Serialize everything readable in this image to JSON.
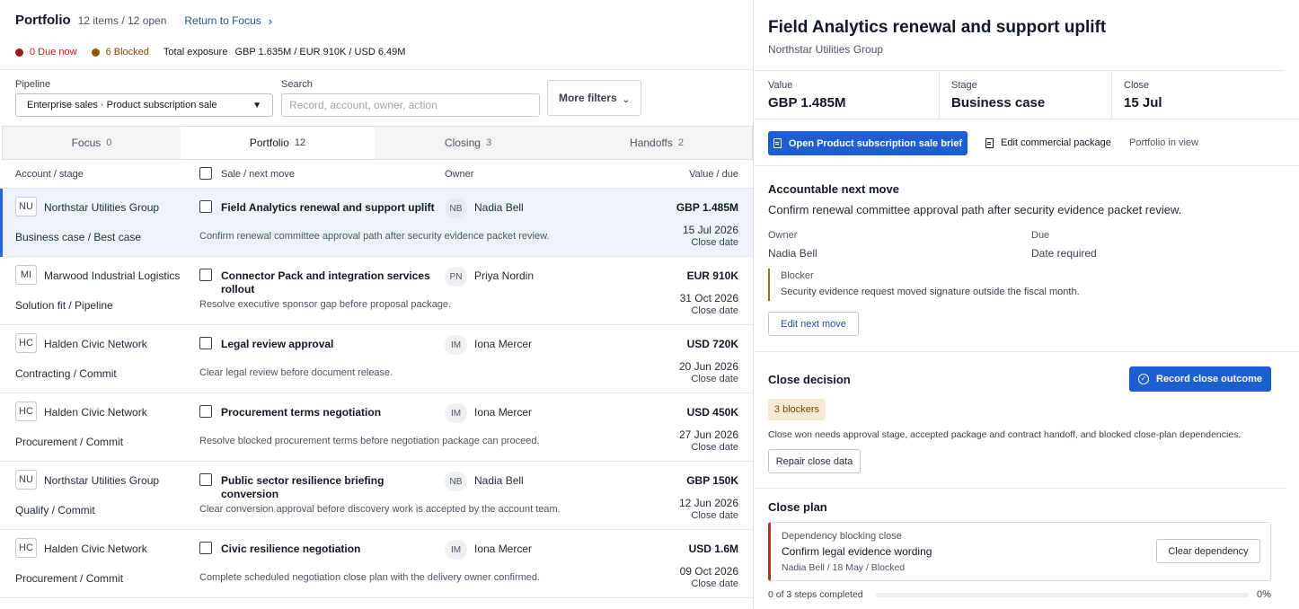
{
  "header": {
    "title": "Portfolio",
    "count": "12 items / 12 open",
    "return_link": "Return to Focus",
    "due_now": "0 Due now",
    "blocked": "6 Blocked",
    "exposure_label": "Total exposure",
    "exposure_value": "GBP 1.635M / EUR 910K / USD 6.49M"
  },
  "colors": {
    "accent": "#1d5fd1",
    "due": "#b91c1c",
    "blocked": "#8a5a00",
    "danger": "#c62828"
  },
  "filters": {
    "pipeline_label": "Pipeline",
    "pipeline_value": "Enterprise sales · Product subscription sale",
    "search_label": "Search",
    "search_placeholder": "Record, account, owner, action",
    "more_filters": "More filters"
  },
  "tabs": [
    {
      "label": "Focus",
      "count": "0"
    },
    {
      "label": "Portfolio",
      "count": "12"
    },
    {
      "label": "Closing",
      "count": "3"
    },
    {
      "label": "Handoffs",
      "count": "2"
    }
  ],
  "columns": {
    "account": "Account / stage",
    "sale": "Sale / next move",
    "owner": "Owner",
    "value": "Value / due"
  },
  "rows": [
    {
      "initials": "NU",
      "account": "Northstar Utilities Group",
      "stage": "Business case / Best case",
      "sale": "Field Analytics renewal and support uplift",
      "next": "Confirm renewal committee approval path after security evidence packet review.",
      "owner_initials": "NB",
      "owner": "Nadia Bell",
      "value": "GBP 1.485M",
      "date": "15 Jul 2026",
      "date_label": "Close date"
    },
    {
      "initials": "MI",
      "account": "Marwood Industrial Logistics",
      "stage": "Solution fit / Pipeline",
      "sale": "Connector Pack and integration services rollout",
      "next": "Resolve executive sponsor gap before proposal package.",
      "owner_initials": "PN",
      "owner": "Priya Nordin",
      "value": "EUR 910K",
      "date": "31 Oct 2026",
      "date_label": "Close date"
    },
    {
      "initials": "HC",
      "account": "Halden Civic Network",
      "stage": "Contracting / Commit",
      "sale": "Legal review approval",
      "next": "Clear legal review before document release.",
      "owner_initials": "IM",
      "owner": "Iona Mercer",
      "value": "USD 720K",
      "date": "20 Jun 2026",
      "date_label": "Close date"
    },
    {
      "initials": "HC",
      "account": "Halden Civic Network",
      "stage": "Procurement / Commit",
      "sale": "Procurement terms negotiation",
      "next": "Resolve blocked procurement terms before negotiation package can proceed.",
      "owner_initials": "IM",
      "owner": "Iona Mercer",
      "value": "USD 450K",
      "date": "27 Jun 2026",
      "date_label": "Close date"
    },
    {
      "initials": "NU",
      "account": "Northstar Utilities Group",
      "stage": "Qualify / Commit",
      "sale": "Public sector resilience briefing conversion",
      "next": "Clear conversion approval before discovery work is accepted by the account team.",
      "owner_initials": "NB",
      "owner": "Nadia Bell",
      "value": "GBP 150K",
      "date": "12 Jun 2026",
      "date_label": "Close date"
    },
    {
      "initials": "HC",
      "account": "Halden Civic Network",
      "stage": "Procurement / Commit",
      "sale": "Civic resilience negotiation",
      "next": "Complete scheduled negotiation close plan with the delivery owner confirmed.",
      "owner_initials": "IM",
      "owner": "Iona Mercer",
      "value": "USD 1.6M",
      "date": "09 Oct 2026",
      "date_label": "Close date"
    }
  ],
  "detail": {
    "title": "Field Analytics renewal and support uplift",
    "account": "Northstar Utilities Group",
    "value_label": "Value",
    "value": "GBP 1.485M",
    "stage_label": "Stage",
    "stage": "Business case",
    "close_label": "Close",
    "close": "15 Jul",
    "open_brief": "Open Product subscription sale brief",
    "edit_package": "Edit commercial package",
    "portfolio_in_view": "Portfolio in view",
    "next_move_heading": "Accountable next move",
    "next_move_text": "Confirm renewal committee approval path after security evidence packet review.",
    "owner_label": "Owner",
    "owner": "Nadia Bell",
    "due_label": "Due",
    "due": "Date required",
    "blocker_label": "Blocker",
    "blocker_text": "Security evidence request moved signature outside the fiscal month.",
    "edit_next_move": "Edit next move",
    "close_decision_heading": "Close decision",
    "record_outcome": "Record close outcome",
    "blockers_badge": "3 blockers",
    "close_decision_text": "Close won needs approval stage, accepted package and contract handoff, and blocked close-plan dependencies.",
    "repair_close_data": "Repair close data",
    "close_plan_heading": "Close plan",
    "plan_item_label": "Dependency blocking close",
    "plan_item_title": "Confirm legal evidence wording",
    "plan_item_meta": "Nadia Bell / 18 May / Blocked",
    "clear_dependency": "Clear dependency",
    "progress_text": "0 of 3 steps completed",
    "progress_pct": "0%",
    "progress_value": 0
  }
}
